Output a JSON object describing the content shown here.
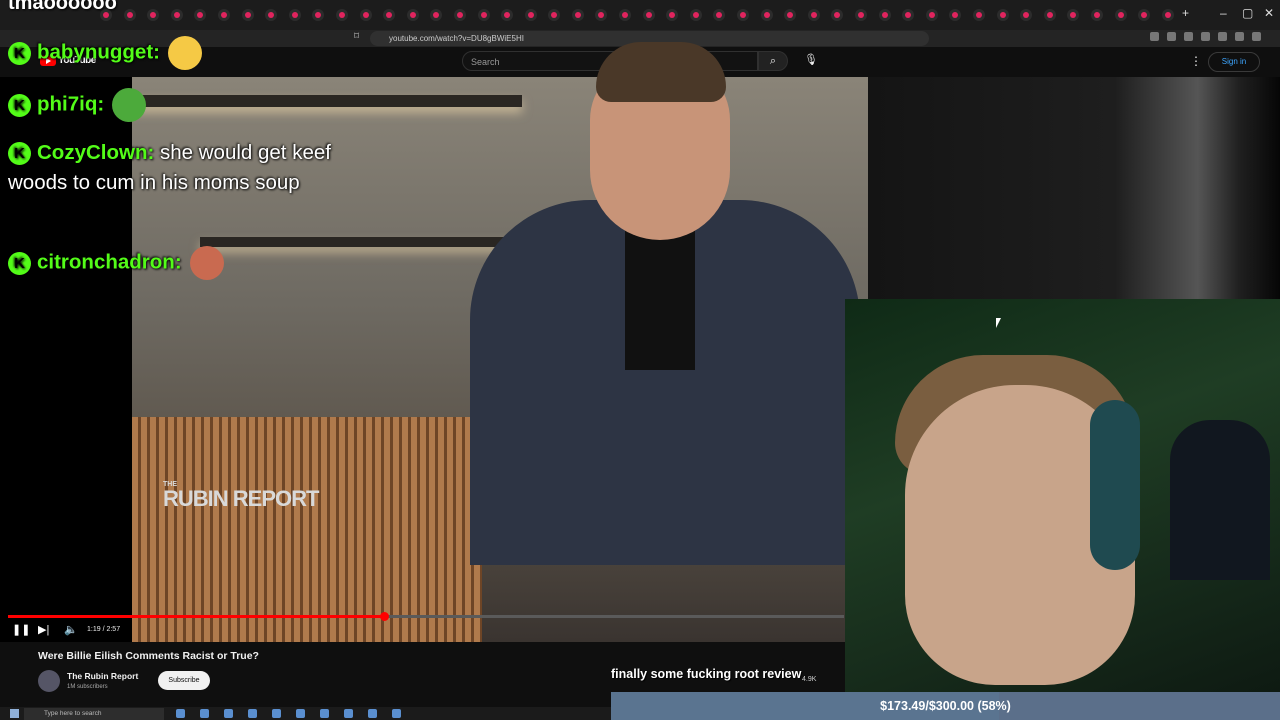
{
  "top_overlay_name": "tmaoooooo",
  "browser": {
    "url": "youtube.com/watch?v=DU8gBWiE5HI",
    "window_controls": [
      "–",
      "▢",
      "✕"
    ]
  },
  "youtube": {
    "logo_text": "YouTube",
    "search_placeholder": "Search",
    "sign_in": "Sign in"
  },
  "video": {
    "title": "Were Billie Eilish Comments Racist or True?",
    "time": "1:19 / 2:57",
    "progress": 0.45,
    "watermark_small": "THE",
    "watermark_big": "RUBIN REPORT",
    "channel_name": "The Rubin Report",
    "subscribers": "1M subscribers",
    "subscribe_label": "Subscribe",
    "likes": "4.9K"
  },
  "chat": [
    {
      "user": "babynugget:",
      "text": "",
      "emote": "laughing-emote",
      "emote_color": "#f5c945"
    },
    {
      "user": "phi7iq:",
      "text": "",
      "emote": "pepe-emote",
      "emote_color": "#4caa3b"
    },
    {
      "user": "CozyClown:",
      "text": "she would get keef woods to cum in his moms soup",
      "emote": "",
      "emote_color": ""
    },
    {
      "user": "citronchadron:",
      "text": "",
      "emote": "face-emote",
      "emote_color": "#c96a50"
    }
  ],
  "caption": "finally some fucking root review",
  "goal": {
    "text": "$173.49/$300.00 (58%)",
    "fraction": 0.58
  },
  "taskbar": {
    "search_placeholder": "Type here to search"
  },
  "colors": {
    "kick_green": "#53fc18",
    "yt_red": "#ff0000"
  }
}
